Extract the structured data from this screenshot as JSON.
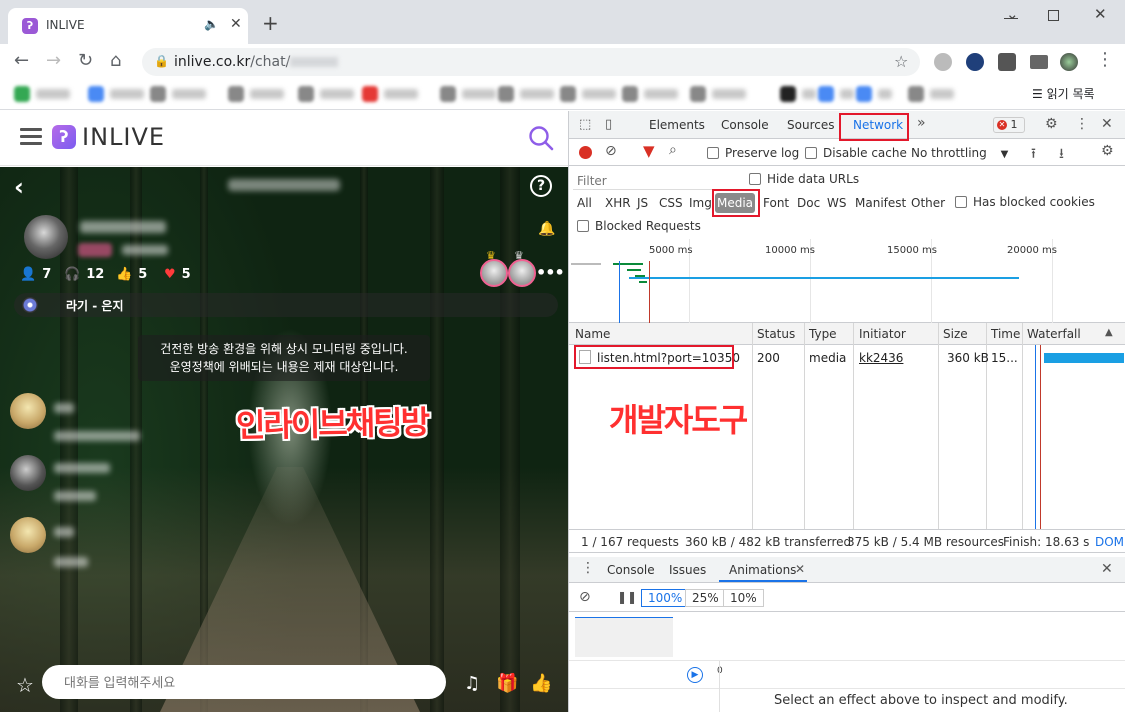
{
  "browser": {
    "tab_title": "INLIVE",
    "tab_favicon": "ʔ",
    "url_host": "inlive.co.kr",
    "url_path": "/chat/",
    "reading_list": "읽기 목록",
    "bookmarks_overflow": "»"
  },
  "site": {
    "logo_mark": "ʔ",
    "logo_text": "INLIVE"
  },
  "room": {
    "stats": {
      "listeners": "7",
      "headphones": "12",
      "likes": "5",
      "hearts": "5"
    },
    "now_playing": "라기 - 은지",
    "notice_line1": "건전한 방송 환경을 위해 상시 모니터링 중입니다.",
    "notice_line2": "운영정책에 위배되는 내용은 제재 대상입니다.",
    "overlay_text": "인라이브채팅방",
    "chat_placeholder": "대화를 입력해주세요"
  },
  "devtools": {
    "tabs": [
      "Elements",
      "Console",
      "Sources",
      "Network"
    ],
    "active_tab": "Network",
    "error_count": "1",
    "preserve_log": "Preserve log",
    "disable_cache": "Disable cache",
    "throttling": "No throttling",
    "filter_placeholder": "Filter",
    "hide_data_urls": "Hide data URLs",
    "filter_types": [
      "All",
      "XHR",
      "JS",
      "CSS",
      "Img",
      "Media",
      "Font",
      "Doc",
      "WS",
      "Manifest",
      "Other"
    ],
    "active_filter": "Media",
    "has_blocked_cookies": "Has blocked cookies",
    "blocked_requests": "Blocked Requests",
    "overview_labels": [
      "5000 ms",
      "10000 ms",
      "15000 ms",
      "20000 ms"
    ],
    "columns": [
      "Name",
      "Status",
      "Type",
      "Initiator",
      "Size",
      "Time",
      "Waterfall"
    ],
    "rows": [
      {
        "name": "listen.html?port=10350",
        "status": "200",
        "type": "media",
        "initiator": "kk2436",
        "size": "360 kB",
        "time": "15..."
      }
    ],
    "overlay_text": "개발자도구",
    "summary": {
      "requests": "1 / 167 requests",
      "transferred": "360 kB / 482 kB transferred",
      "resources": "375 kB / 5.4 MB resources",
      "finish": "Finish: 18.63 s",
      "dom": "DOM"
    },
    "drawer_tabs": [
      "Console",
      "Issues",
      "Animations"
    ],
    "active_drawer": "Animations",
    "rates": [
      "100%",
      "25%",
      "10%"
    ],
    "timeline_zero": "0",
    "anim_hint": "Select an effect above to inspect and modify."
  },
  "colors": {
    "accent_red": "#e3182b",
    "inlive_purple": "#9b59d6",
    "waterfall_blue": "#1a9fe3"
  }
}
